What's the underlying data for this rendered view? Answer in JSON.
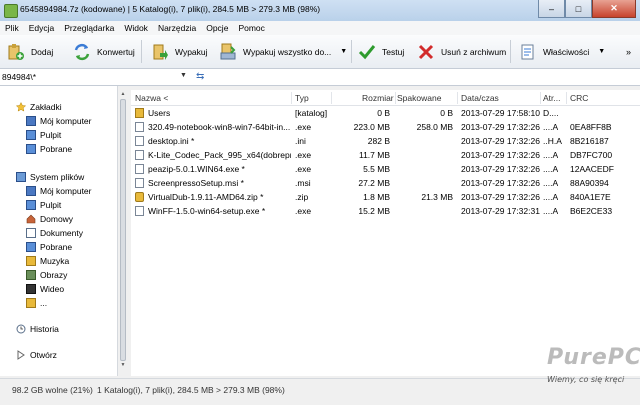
{
  "window": {
    "title": "6545894984.7z (kodowane) | 5 Katalog(i), 7 plik(i), 284.5 MB > 279.3 MB (98%)",
    "min": "–",
    "max": "□",
    "close": "✕"
  },
  "menu": [
    "Plik",
    "Edycja",
    "Przeglądarka",
    "Widok",
    "Narzędzia",
    "Opcje",
    "Pomoc"
  ],
  "toolbar": {
    "add": "Dodaj",
    "convert": "Konwertuj",
    "extract": "Wypakuj",
    "extract_all": "Wypakuj wszystko do...",
    "test": "Testuj",
    "delete": "Usuń z archiwum",
    "properties": "Właściwości",
    "dropdown": "▼"
  },
  "path": {
    "value": "894984\\*",
    "dropdown": "▼",
    "go": "⇆"
  },
  "sidebar": {
    "bookmarks": "Zakładki",
    "bookmark_items": [
      "Mój komputer",
      "Pulpit",
      "Pobrane"
    ],
    "system": "System plików",
    "system_items": [
      "Mój komputer",
      "Pulpit",
      "Domowy",
      "Dokumenty",
      "Pobrane",
      "Muzyka",
      "Obrazy",
      "Wideo",
      "..."
    ],
    "history": "Historia",
    "open": "Otwórz"
  },
  "columns": [
    "Nazwa <",
    "Typ",
    "Rozmiar",
    "Spakowane",
    "Data/czas",
    "Atr...",
    "CRC"
  ],
  "rows": [
    {
      "name": "Users",
      "type": "[katalog]",
      "size": "0 B",
      "packed": "0 B",
      "date": "2013-07-29 17:58:10",
      "attr": "D....",
      "crc": "",
      "icon": "folder-icon"
    },
    {
      "name": "320.49-notebook-win8-win7-64bit-in...",
      "type": ".exe",
      "size": "223.0 MB",
      "packed": "258.0 MB",
      "date": "2013-07-29 17:32:26",
      "attr": "....A",
      "crc": "0EA8FF8B",
      "icon": "file-icon"
    },
    {
      "name": "desktop.ini *",
      "type": ".ini",
      "size": "282 B",
      "packed": "",
      "date": "2013-07-29 17:32:26",
      "attr": "..H.A",
      "crc": "8B216187",
      "icon": "file-icon"
    },
    {
      "name": "K-Lite_Codec_Pack_995_x64(dobrepr...",
      "type": ".exe",
      "size": "11.7 MB",
      "packed": "",
      "date": "2013-07-29 17:32:26",
      "attr": "....A",
      "crc": "DB7FC700",
      "icon": "file-icon"
    },
    {
      "name": "peazip-5.0.1.WIN64.exe *",
      "type": ".exe",
      "size": "5.5 MB",
      "packed": "",
      "date": "2013-07-29 17:32:26",
      "attr": "....A",
      "crc": "12AACEDF",
      "icon": "file-icon"
    },
    {
      "name": "ScreenpressoSetup.msi *",
      "type": ".msi",
      "size": "27.2 MB",
      "packed": "",
      "date": "2013-07-29 17:32:26",
      "attr": "....A",
      "crc": "88A90394",
      "icon": "file-icon"
    },
    {
      "name": "VirtualDub-1.9.11-AMD64.zip *",
      "type": ".zip",
      "size": "1.8 MB",
      "packed": "21.3 MB",
      "date": "2013-07-29 17:32:26",
      "attr": "....A",
      "crc": "840A1E7E",
      "icon": "zip-icon"
    },
    {
      "name": "WinFF-1.5.0-win64-setup.exe *",
      "type": ".exe",
      "size": "15.2 MB",
      "packed": "",
      "date": "2013-07-29 17:32:31",
      "attr": "....A",
      "crc": "B6E2CE33",
      "icon": "file-icon"
    }
  ],
  "status": {
    "free": "98.2 GB wolne (21%)",
    "summary": "1 Katalog(i), 7 plik(i), 284.5 MB > 279.3 MB (98%)"
  },
  "watermark": {
    "big": "PurePC",
    "small": "Wiemy, co się kręci"
  },
  "colors": {
    "folder": "#e8b93a",
    "accent": "#3b6fb8"
  }
}
